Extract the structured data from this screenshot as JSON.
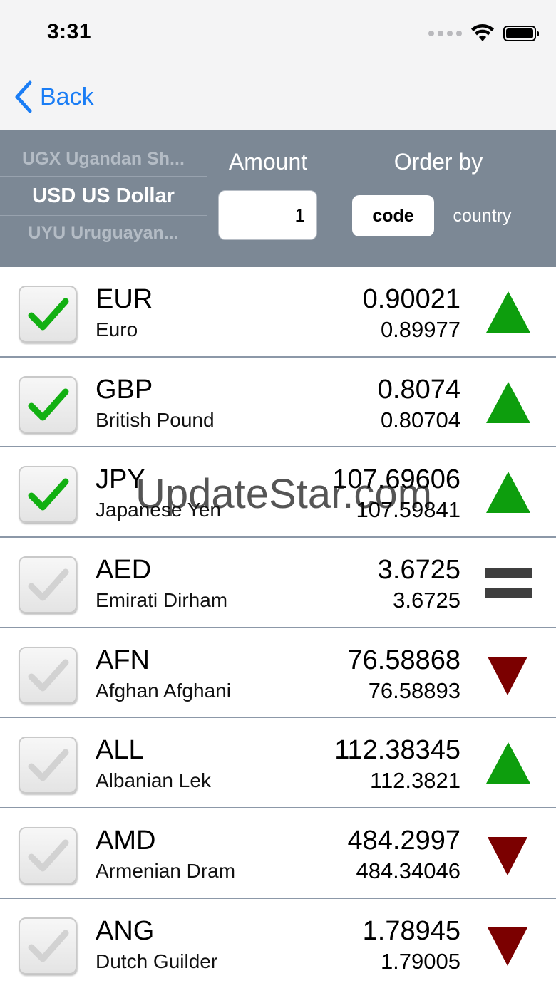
{
  "status_bar": {
    "time": "3:31"
  },
  "nav": {
    "back_label": "Back"
  },
  "controls": {
    "picker": {
      "above": "UGX Ugandan Sh...",
      "selected": "USD US Dollar",
      "below": "UYU Uruguayan..."
    },
    "amount_label": "Amount",
    "amount_value": "1",
    "order_label": "Order by",
    "order_options": {
      "code": "code",
      "country": "country"
    },
    "order_selected": "code"
  },
  "rows": [
    {
      "code": "EUR",
      "name": "Euro",
      "rate": "0.90021",
      "previous": "0.89977",
      "checked": true,
      "trend": "up"
    },
    {
      "code": "GBP",
      "name": "British Pound",
      "rate": "0.8074",
      "previous": "0.80704",
      "checked": true,
      "trend": "up"
    },
    {
      "code": "JPY",
      "name": "Japanese Yen",
      "rate": "107.69606",
      "previous": "107.59841",
      "checked": true,
      "trend": "up"
    },
    {
      "code": "AED",
      "name": "Emirati Dirham",
      "rate": "3.6725",
      "previous": "3.6725",
      "checked": false,
      "trend": "equal"
    },
    {
      "code": "AFN",
      "name": "Afghan Afghani",
      "rate": "76.58868",
      "previous": "76.58893",
      "checked": false,
      "trend": "down"
    },
    {
      "code": "ALL",
      "name": "Albanian Lek",
      "rate": "112.38345",
      "previous": "112.3821",
      "checked": false,
      "trend": "up"
    },
    {
      "code": "AMD",
      "name": "Armenian Dram",
      "rate": "484.2997",
      "previous": "484.34046",
      "checked": false,
      "trend": "down"
    },
    {
      "code": "ANG",
      "name": "Dutch Guilder",
      "rate": "1.78945",
      "previous": "1.79005",
      "checked": false,
      "trend": "down"
    }
  ],
  "colors": {
    "up": "#0d9e0d",
    "down": "#7b0000",
    "equal": "#3f3f3f",
    "check_on": "#12b012",
    "check_off": "#d2d2d2",
    "accent": "#1a7df5"
  },
  "watermark": "UpdateStar.com"
}
